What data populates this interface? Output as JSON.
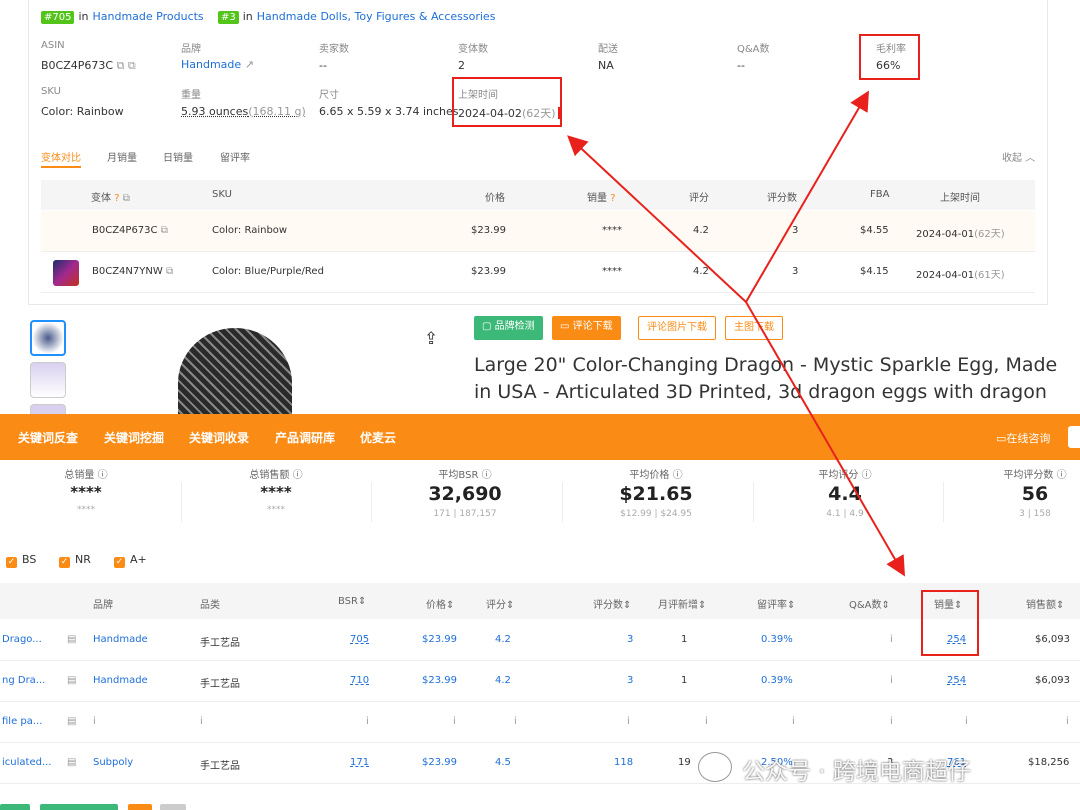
{
  "ranks": [
    {
      "num": "#705",
      "in": "in",
      "cat": "Handmade Products"
    },
    {
      "num": "#3",
      "in": "in",
      "cat": "Handmade Dolls, Toy Figures & Accessories"
    }
  ],
  "info": {
    "asin_l": "ASIN",
    "asin_v": "B0CZ4P673C",
    "brand_l": "品牌",
    "brand_v": "Handmade",
    "sellers_l": "卖家数",
    "sellers_v": "--",
    "variants_l": "变体数",
    "variants_v": "2",
    "ship_l": "配送",
    "ship_v": "NA",
    "qa_l": "Q&A数",
    "qa_v": "--",
    "margin_l": "毛利率",
    "margin_v": "66%",
    "sku_l": "SKU",
    "sku_v": "Color: Rainbow",
    "weight_l": "重量",
    "weight_v": "5.93 ounces",
    "weight_g": "(168.11 g)",
    "size_l": "尺寸",
    "size_v": "6.65 x 5.59 x 3.74 inches",
    "date_l": "上架时间",
    "date_v": "2024-04-02",
    "date_d": "(62天)"
  },
  "tabs": [
    "变体对比",
    "月销量",
    "日销量",
    "留评率"
  ],
  "collapse": "收起",
  "vtable": {
    "headers": [
      "变体",
      "SKU",
      "价格",
      "销量",
      "评分",
      "评分数",
      "FBA",
      "上架时间"
    ],
    "rows": [
      {
        "asin": "B0CZ4P673C",
        "sku": "Color: Rainbow",
        "price": "$23.99",
        "sales": "****",
        "rating": "4.2",
        "count": "3",
        "fba": "$4.55",
        "date": "2024-04-01",
        "days": "(62天)"
      },
      {
        "asin": "B0CZ4N7YNW",
        "sku": "Color: Blue/Purple/Red",
        "price": "$23.99",
        "sales": "****",
        "rating": "4.2",
        "count": "3",
        "fba": "$4.15",
        "date": "2024-04-01",
        "days": "(61天)"
      }
    ]
  },
  "buttons": [
    "品牌检测",
    "评论下载",
    "评论图片下载",
    "主图下载"
  ],
  "title": "Large 20\" Color-Changing Dragon - Mystic Sparkle Egg, Made in USA - Articulated 3D Printed, 3d dragon eggs with dragon",
  "nav": [
    "关键词反查",
    "关键词挖掘",
    "关键词收录",
    "产品调研库",
    "优麦云"
  ],
  "online": "在线咨询",
  "stats": [
    {
      "l": "总销量",
      "v": "****",
      "s": "****"
    },
    {
      "l": "总销售额",
      "v": "****",
      "s": "****"
    },
    {
      "l": "平均BSR",
      "v": "32,690",
      "s": "171 | 187,157"
    },
    {
      "l": "平均价格",
      "v": "$21.65",
      "s": "$12.99 | $24.95"
    },
    {
      "l": "平均评分",
      "v": "4.4",
      "s": "4.1 | 4.9"
    },
    {
      "l": "平均评分数",
      "v": "56",
      "s": "3 | 158"
    }
  ],
  "checks": [
    "BS",
    "NR",
    "A+"
  ],
  "btable": {
    "headers": [
      "品牌",
      "品类",
      "BSR",
      "价格",
      "评分",
      "评分数",
      "月评新增",
      "留评率",
      "Q&A数",
      "销量",
      "销售额"
    ],
    "rows": [
      {
        "name": "Drago...",
        "brand": "Handmade",
        "cat": "手工艺品",
        "bsr": "705",
        "price": "$23.99",
        "rating": "4.2",
        "count": "3",
        "new": "1",
        "rate": "0.39%",
        "qa": "i",
        "sales": "254",
        "rev": "$6,093"
      },
      {
        "name": "ng Dra...",
        "brand": "Handmade",
        "cat": "手工艺品",
        "bsr": "710",
        "price": "$23.99",
        "rating": "4.2",
        "count": "3",
        "new": "1",
        "rate": "0.39%",
        "qa": "i",
        "sales": "254",
        "rev": "$6,093"
      },
      {
        "name": "file pa...",
        "brand": "i",
        "cat": "i",
        "bsr": "i",
        "price": "i",
        "rating": "i",
        "count": "i",
        "new": "i",
        "rate": "i",
        "qa": "i",
        "sales": "i",
        "rev": "i"
      },
      {
        "name": "iculated...",
        "brand": "Subpoly",
        "cat": "手工艺品",
        "bsr": "171",
        "price": "$23.99",
        "rating": "4.5",
        "count": "118",
        "new": "19",
        "rate": "2.50%",
        "qa": "3",
        "sales": "761",
        "rev": "$18,256"
      }
    ]
  },
  "watermark": "公众号 · 跨境电商超仔"
}
